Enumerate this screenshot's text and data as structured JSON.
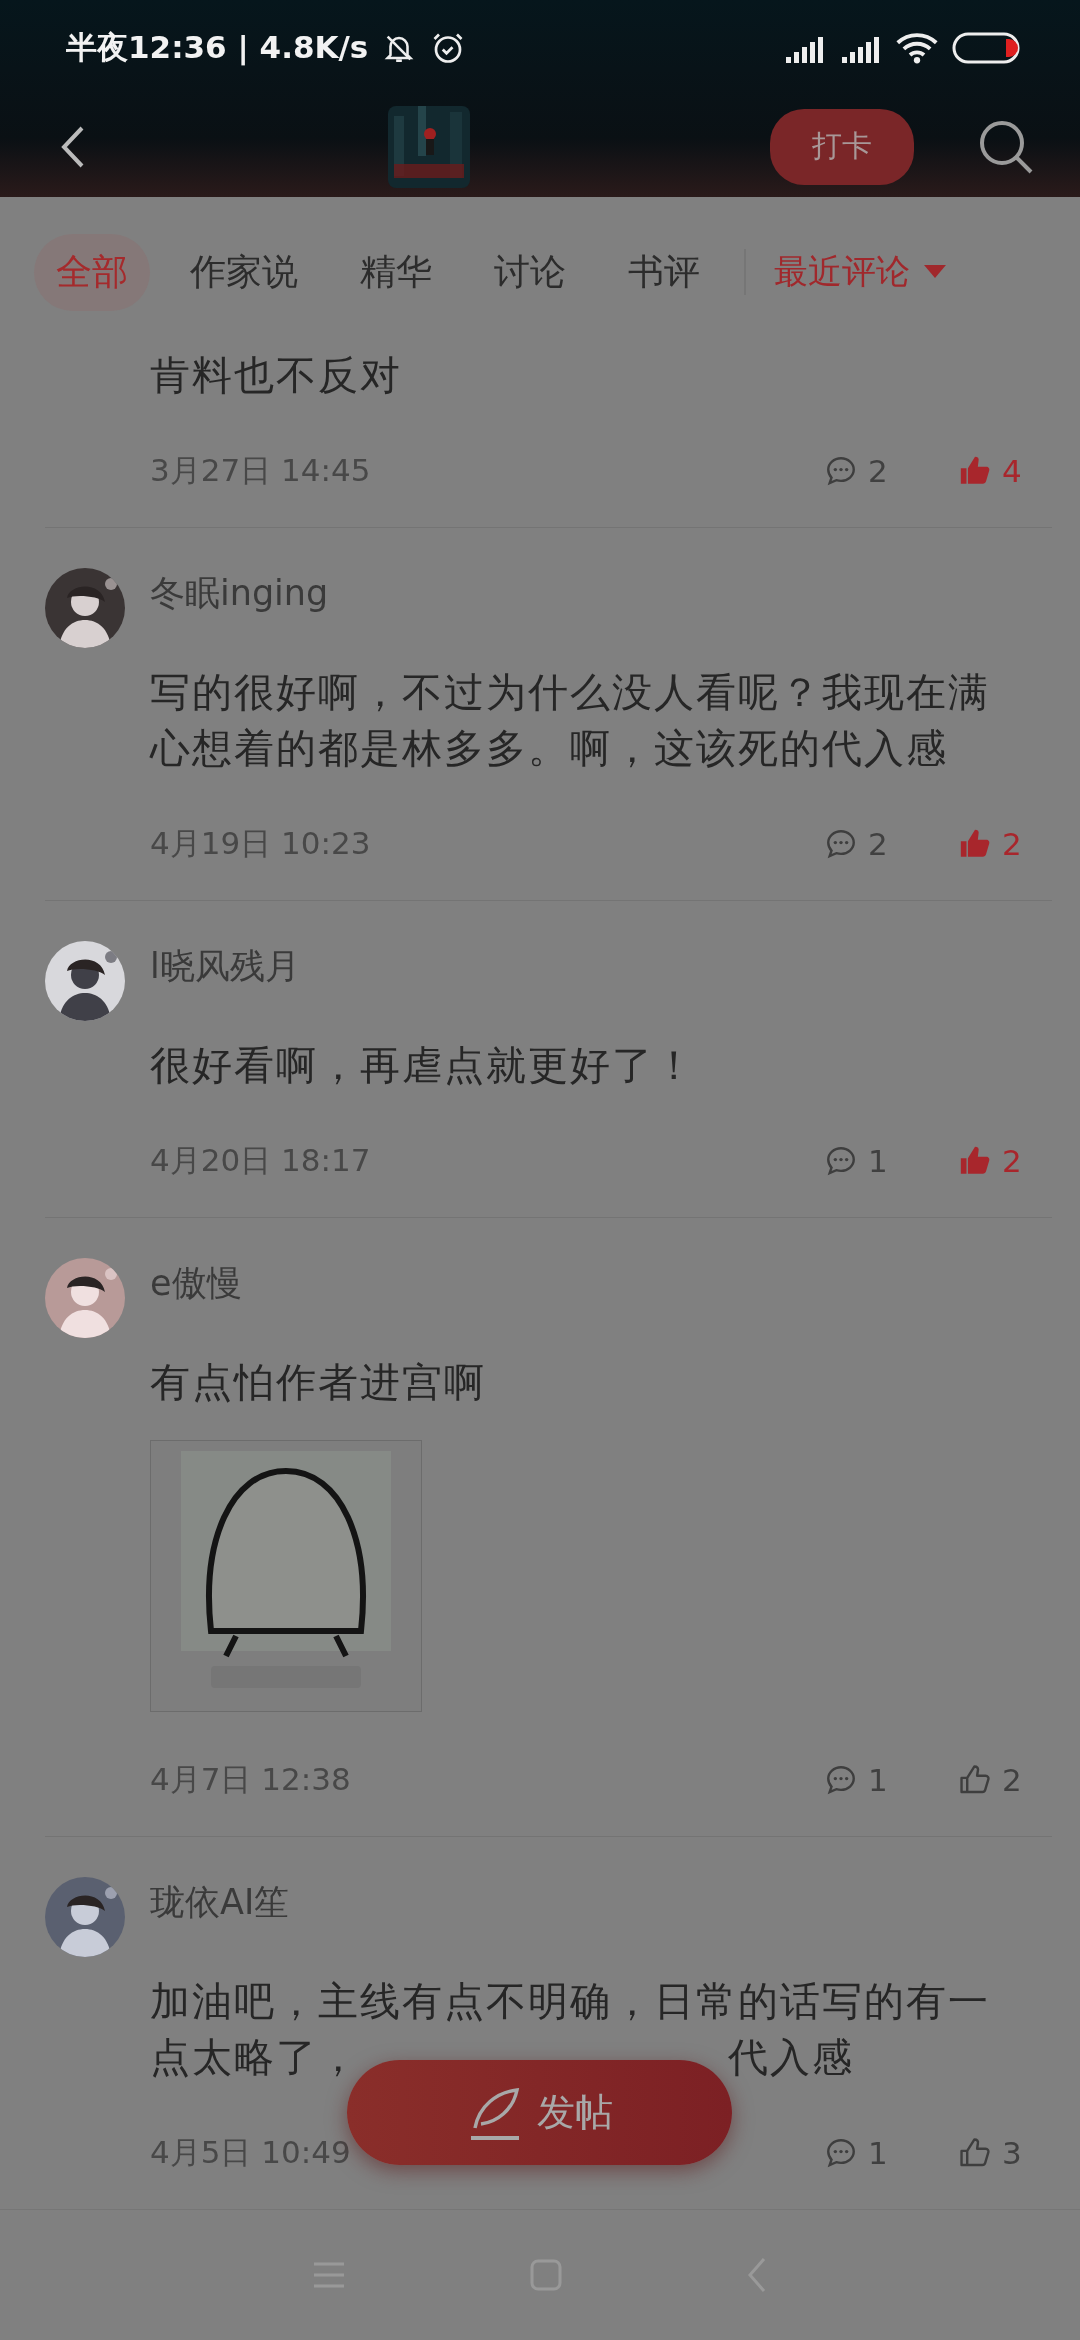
{
  "status_bar": {
    "time": "半夜12:36 | 4.8K/s"
  },
  "header": {
    "checkin_button": "打卡"
  },
  "tabs": [
    {
      "label": "全部",
      "selected": true
    },
    {
      "label": "作家说",
      "selected": false
    },
    {
      "label": "精华",
      "selected": false
    },
    {
      "label": "讨论",
      "selected": false
    },
    {
      "label": "书评",
      "selected": false
    }
  ],
  "sort": {
    "label": "最近评论"
  },
  "comments": [
    {
      "text": "肯料也不反对",
      "date": "3月27日 14:45",
      "replies": "2",
      "likes": "4",
      "liked": true
    },
    {
      "user": "冬眠inging",
      "text": "写的很好啊，不过为什么没人看呢？我现在满心想着的都是林多多。啊，这该死的代入感",
      "date": "4月19日 10:23",
      "replies": "2",
      "likes": "2",
      "liked": true
    },
    {
      "user": "l晓风残月",
      "text": "很好看啊，再虐点就更好了！",
      "date": "4月20日 18:17",
      "replies": "1",
      "likes": "2",
      "liked": true
    },
    {
      "user": "e傲慢",
      "text": "有点怕作者进宫啊",
      "date": "4月7日 12:38",
      "replies": "1",
      "likes": "2",
      "liked": false
    },
    {
      "user": "珑依AI笙",
      "text": [
        "加油吧，主线有点不明确，日常的话写的有一",
        "点太略了，",
        "代入感"
      ],
      "date": "4月5日 10:49",
      "replies": "1",
      "likes": "3",
      "liked": false
    }
  ],
  "post_button": "发帖"
}
